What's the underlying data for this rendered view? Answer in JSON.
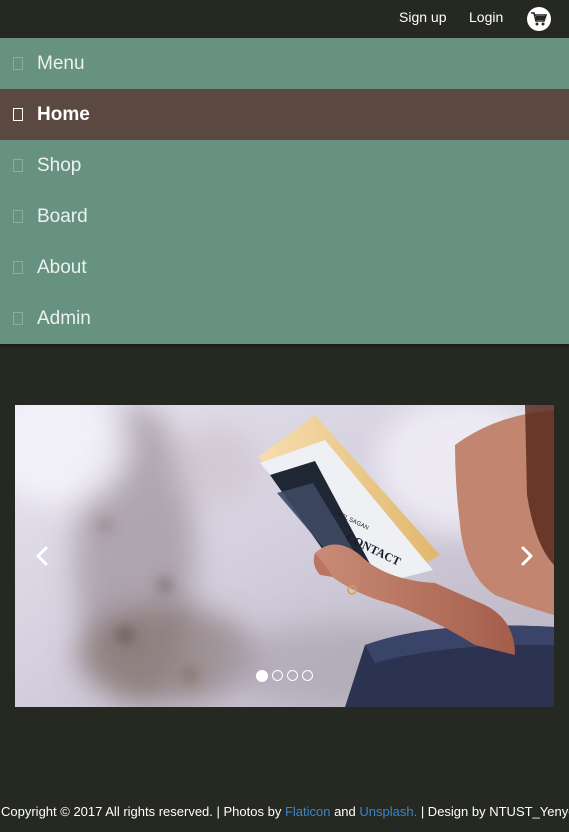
{
  "header": {
    "signup_label": "Sign up",
    "login_label": "Login",
    "cart_icon": "cart-icon"
  },
  "menu": {
    "items": [
      {
        "label": "Menu",
        "active": false
      },
      {
        "label": "Home",
        "active": true
      },
      {
        "label": "Shop",
        "active": false
      },
      {
        "label": "Board",
        "active": false
      },
      {
        "label": "About",
        "active": false
      },
      {
        "label": "Admin",
        "active": false
      }
    ]
  },
  "carousel": {
    "slide_count": 4,
    "active_slide": 1,
    "prev_icon": "chevron-left-icon",
    "next_icon": "chevron-right-icon",
    "book": {
      "title": "CONTACT",
      "author": "CARL SAGAN"
    }
  },
  "footer": {
    "copyright": "Copyright © 2017 All rights reserved. | Photos by ",
    "flaticon": "Flaticon",
    "and": " and ",
    "unsplash": "Unsplash.",
    "design": " | Design by NTUST_Yenyen"
  },
  "colors": {
    "background": "#262822",
    "menu": "#679181",
    "menu_active": "#5b4841",
    "link": "#3c85c7"
  }
}
